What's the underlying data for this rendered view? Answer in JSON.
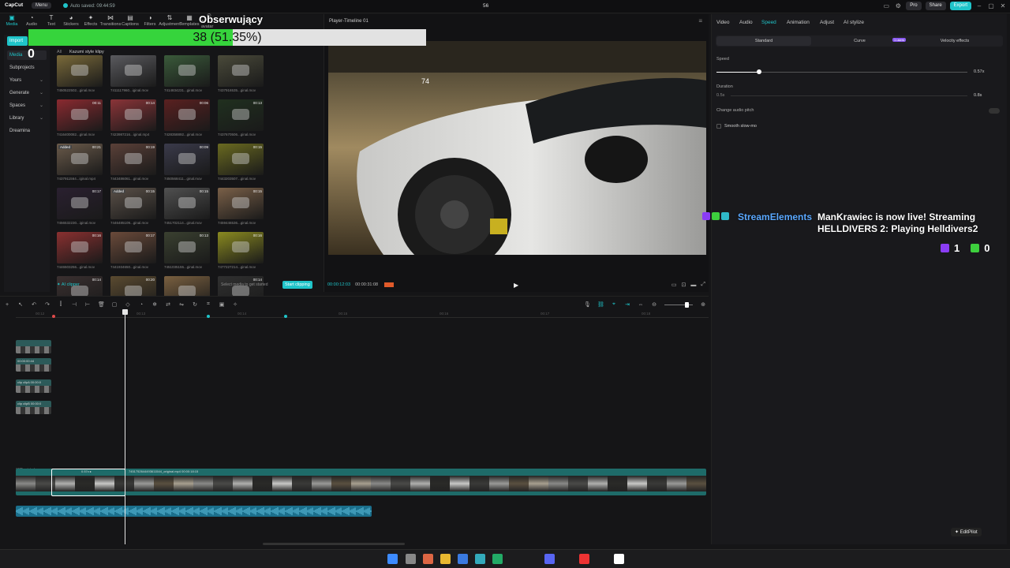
{
  "app": {
    "name": "CapCut",
    "menu": "Menu",
    "autosave": "Auto saved: 09:44:59",
    "project": "56",
    "pro": "Pro",
    "share": "Share",
    "export": "Export"
  },
  "tooltabs": [
    {
      "label": "Media",
      "icon": "media-icon"
    },
    {
      "label": "Audio",
      "icon": "audio-icon"
    },
    {
      "label": "Text",
      "icon": "text-icon"
    },
    {
      "label": "Stickers",
      "icon": "sticker-icon"
    },
    {
      "label": "Effects",
      "icon": "effects-icon"
    },
    {
      "label": "Transitions",
      "icon": "transitions-icon"
    },
    {
      "label": "Captions",
      "icon": "captions-icon"
    },
    {
      "label": "Filters",
      "icon": "filters-icon"
    },
    {
      "label": "Adjustment",
      "icon": "adjustment-icon"
    },
    {
      "label": "Templates",
      "icon": "templates-icon"
    },
    {
      "label": "AI avatar",
      "icon": "avatar-icon"
    }
  ],
  "sidebar": {
    "import": "Import",
    "items": [
      "Media",
      "Subprojects",
      "Yours",
      "Generate",
      "Spaces",
      "Library",
      "Dreamina"
    ]
  },
  "media": {
    "tabs": [
      "All",
      "Kazumi style klipy"
    ],
    "ai_clipper": "AI clipper",
    "hint": "Select media to get started",
    "start_clipping": "Start clipping",
    "thumbs": [
      {
        "dur": "",
        "name": "7450522502...ginal.mov",
        "c": "#7a6a3a"
      },
      {
        "dur": "",
        "name": "7411117960...iginal.mov",
        "c": "#5a5a5e"
      },
      {
        "dur": "",
        "name": "7414834231...ginal.mov",
        "c": "#3a5a3a"
      },
      {
        "dur": "",
        "name": "7437916535...ginal.mov",
        "c": "#4a4a3a"
      },
      {
        "dur": "00:11",
        "name": "7416400082...ginal.mov",
        "c": "#8a2a30"
      },
      {
        "dur": "00:14",
        "name": "7423987216...iginal.mp4",
        "c": "#8a3438"
      },
      {
        "dur": "00:06",
        "name": "7428358892...ginal.mov",
        "c": "#5a2020"
      },
      {
        "dur": "00:13",
        "name": "7437670506...ginal.mov",
        "c": "#20301f"
      },
      {
        "dur": "00:21",
        "name": "7437911564...iginal.mp4",
        "c": "#6a5a4a",
        "added": "Added"
      },
      {
        "dur": "00:19",
        "name": "7443486061...ginal.mov",
        "c": "#5a4038"
      },
      {
        "dur": "00:09",
        "name": "7450568411...ginal.mov",
        "c": "#3a3a4a"
      },
      {
        "dur": "00:15",
        "name": "7443203507...ginal.mov",
        "c": "#6a6a20"
      },
      {
        "dur": "00:17",
        "name": "7456532230...iginal.mov",
        "c": "#2a2030"
      },
      {
        "dur": "00:15",
        "name": "7446485109...ginal.mov",
        "c": "#5a5048",
        "added": "Added"
      },
      {
        "dur": "00:15",
        "name": "7451702114...ginal.mov",
        "c": "#505050"
      },
      {
        "dur": "00:15",
        "name": "7459446536...ginal.mov",
        "c": "#7a6048"
      },
      {
        "dur": "00:16",
        "name": "7446503256...ginal.mov",
        "c": "#8a3030"
      },
      {
        "dur": "00:17",
        "name": "7441934650...ginal.mov",
        "c": "#6a4a3a"
      },
      {
        "dur": "00:13",
        "name": "7451035155...ginal.mov",
        "c": "#3a4030"
      },
      {
        "dur": "00:16",
        "name": "7477227214...ginal.mov",
        "c": "#8a8a20"
      },
      {
        "dur": "00:14",
        "name": "",
        "c": "#3a3030"
      },
      {
        "dur": "00:20",
        "name": "",
        "c": "#5a4a30"
      },
      {
        "dur": "",
        "name": "",
        "c": "#7a6040"
      },
      {
        "dur": "00:14",
        "name": "",
        "c": "#303030"
      }
    ]
  },
  "overlay": {
    "title": "Obserwujący",
    "progress_text": "38 (51.35%)",
    "progress": 0.5135,
    "media_count": "0",
    "frame_number": "74"
  },
  "player": {
    "title": "Player-Timeline 01",
    "time_current": "00:00:12:03",
    "time_total": "00:00:31:08"
  },
  "right": {
    "tabs": [
      "Video",
      "Audio",
      "Speed",
      "Animation",
      "Adjust",
      "AI stylize"
    ],
    "segments": [
      "Standard",
      "Curve",
      "Velocity effects"
    ],
    "new_badge": "1 users",
    "speed_label": "Speed",
    "speed_value": "0.57x",
    "speed_fraction": 0.54,
    "duration_label": "Duration",
    "duration_from": "0.5s",
    "duration_to": "0.8s",
    "audio_pitch": "Change audio pitch",
    "smooth": "Smooth slow-mo"
  },
  "stream": {
    "name": "StreamElements",
    "message": "ManKrawiec is now live! Streaming HELLDIVERS 2: Playing Helldivers2",
    "count_a": "1",
    "count_b": "0"
  },
  "timeline": {
    "ticks": [
      "00:12",
      "00:13",
      "00:14",
      "00:15",
      "00:16",
      "00:17",
      "00:18"
    ],
    "clip_label": "7451752644493611544_original.mp4  00:00:18:15",
    "clip_label2": "0.57x ▸",
    "clip_label0": "1970_original.mov",
    "mini_clip_labels": [
      "",
      "00:00:00:44",
      "clip clipA 00:00:0",
      "clip clipB 00:00:0"
    ]
  },
  "editpilot": "EditPilot"
}
